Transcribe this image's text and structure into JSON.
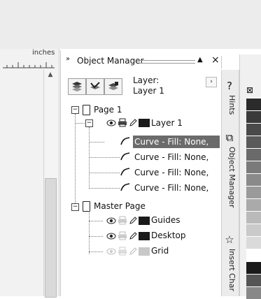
{
  "ruler": {
    "unit": "inches"
  },
  "scroll_up_glyph": "▲",
  "object_manager": {
    "title_grip": "››",
    "title": "Object Manager",
    "collapse_glyph": "▲",
    "close_glyph": "×",
    "layer_label": "Layer:",
    "layer_name": "Layer 1",
    "layer_menu_glyph": "›"
  },
  "tree": {
    "page1": {
      "expander": "−",
      "label": "Page 1",
      "layer": {
        "expander": "−",
        "label": "Layer 1",
        "color": "#1a1a1a",
        "curves": [
          {
            "label": "Curve - Fill: None,",
            "selected": true
          },
          {
            "label": "Curve - Fill: None,",
            "selected": false
          },
          {
            "label": "Curve - Fill: None,",
            "selected": false
          },
          {
            "label": "Curve - Fill: None,",
            "selected": false
          }
        ]
      }
    },
    "master_page": {
      "expander": "−",
      "label": "Master Page",
      "layers": [
        {
          "label": "Guides",
          "color": "#1a1a1a",
          "visible": true
        },
        {
          "label": "Desktop",
          "color": "#1a1a1a",
          "visible": true
        },
        {
          "label": "Grid",
          "color": "#c8c8c8",
          "visible": false
        }
      ]
    }
  },
  "side_tabs": [
    {
      "label": "Hints",
      "icon": "question-arrow-icon",
      "glyph": "?"
    },
    {
      "label": "Object Manager",
      "icon": "layers-icon",
      "glyph": "⧉"
    },
    {
      "label": "Insert Char",
      "icon": "star-icon",
      "glyph": "☆"
    }
  ],
  "palette": {
    "header_glyph": "⊠",
    "colors": [
      "#2b2b2b",
      "#3a3a3a",
      "#4a4a4a",
      "#5a5a5a",
      "#6a6a6a",
      "#7a7a7a",
      "#8a8a8a",
      "#9a9a9a",
      "#aaaaaa",
      "#bababa",
      "#cacaca",
      "#dadada",
      "#ffffff",
      "#1a1a1a",
      "#555555",
      "#888888"
    ]
  },
  "colors": {
    "selected_row": "#6b6b6b",
    "docker_bg": "#ffffff",
    "chrome_bg": "#ececec"
  }
}
